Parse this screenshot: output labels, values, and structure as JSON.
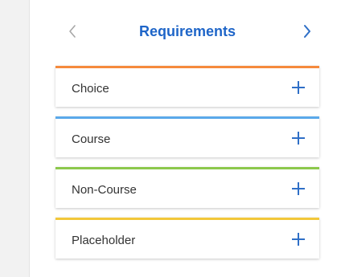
{
  "header": {
    "title": "Requirements",
    "prev_icon": "chevron-left-icon",
    "next_icon": "chevron-right-icon"
  },
  "colors": {
    "title": "#1e65c8",
    "prev_disabled": "#a7a7a7",
    "next_active": "#2f6fc7",
    "plus": "#2f6fc7"
  },
  "cards": [
    {
      "label": "Choice",
      "accent": "#f58a3c",
      "icon": "plus-icon"
    },
    {
      "label": "Course",
      "accent": "#5aa9ea",
      "icon": "plus-icon"
    },
    {
      "label": "Non-Course",
      "accent": "#8cc84b",
      "icon": "plus-icon"
    },
    {
      "label": "Placeholder",
      "accent": "#f2c73a",
      "icon": "plus-icon"
    }
  ]
}
